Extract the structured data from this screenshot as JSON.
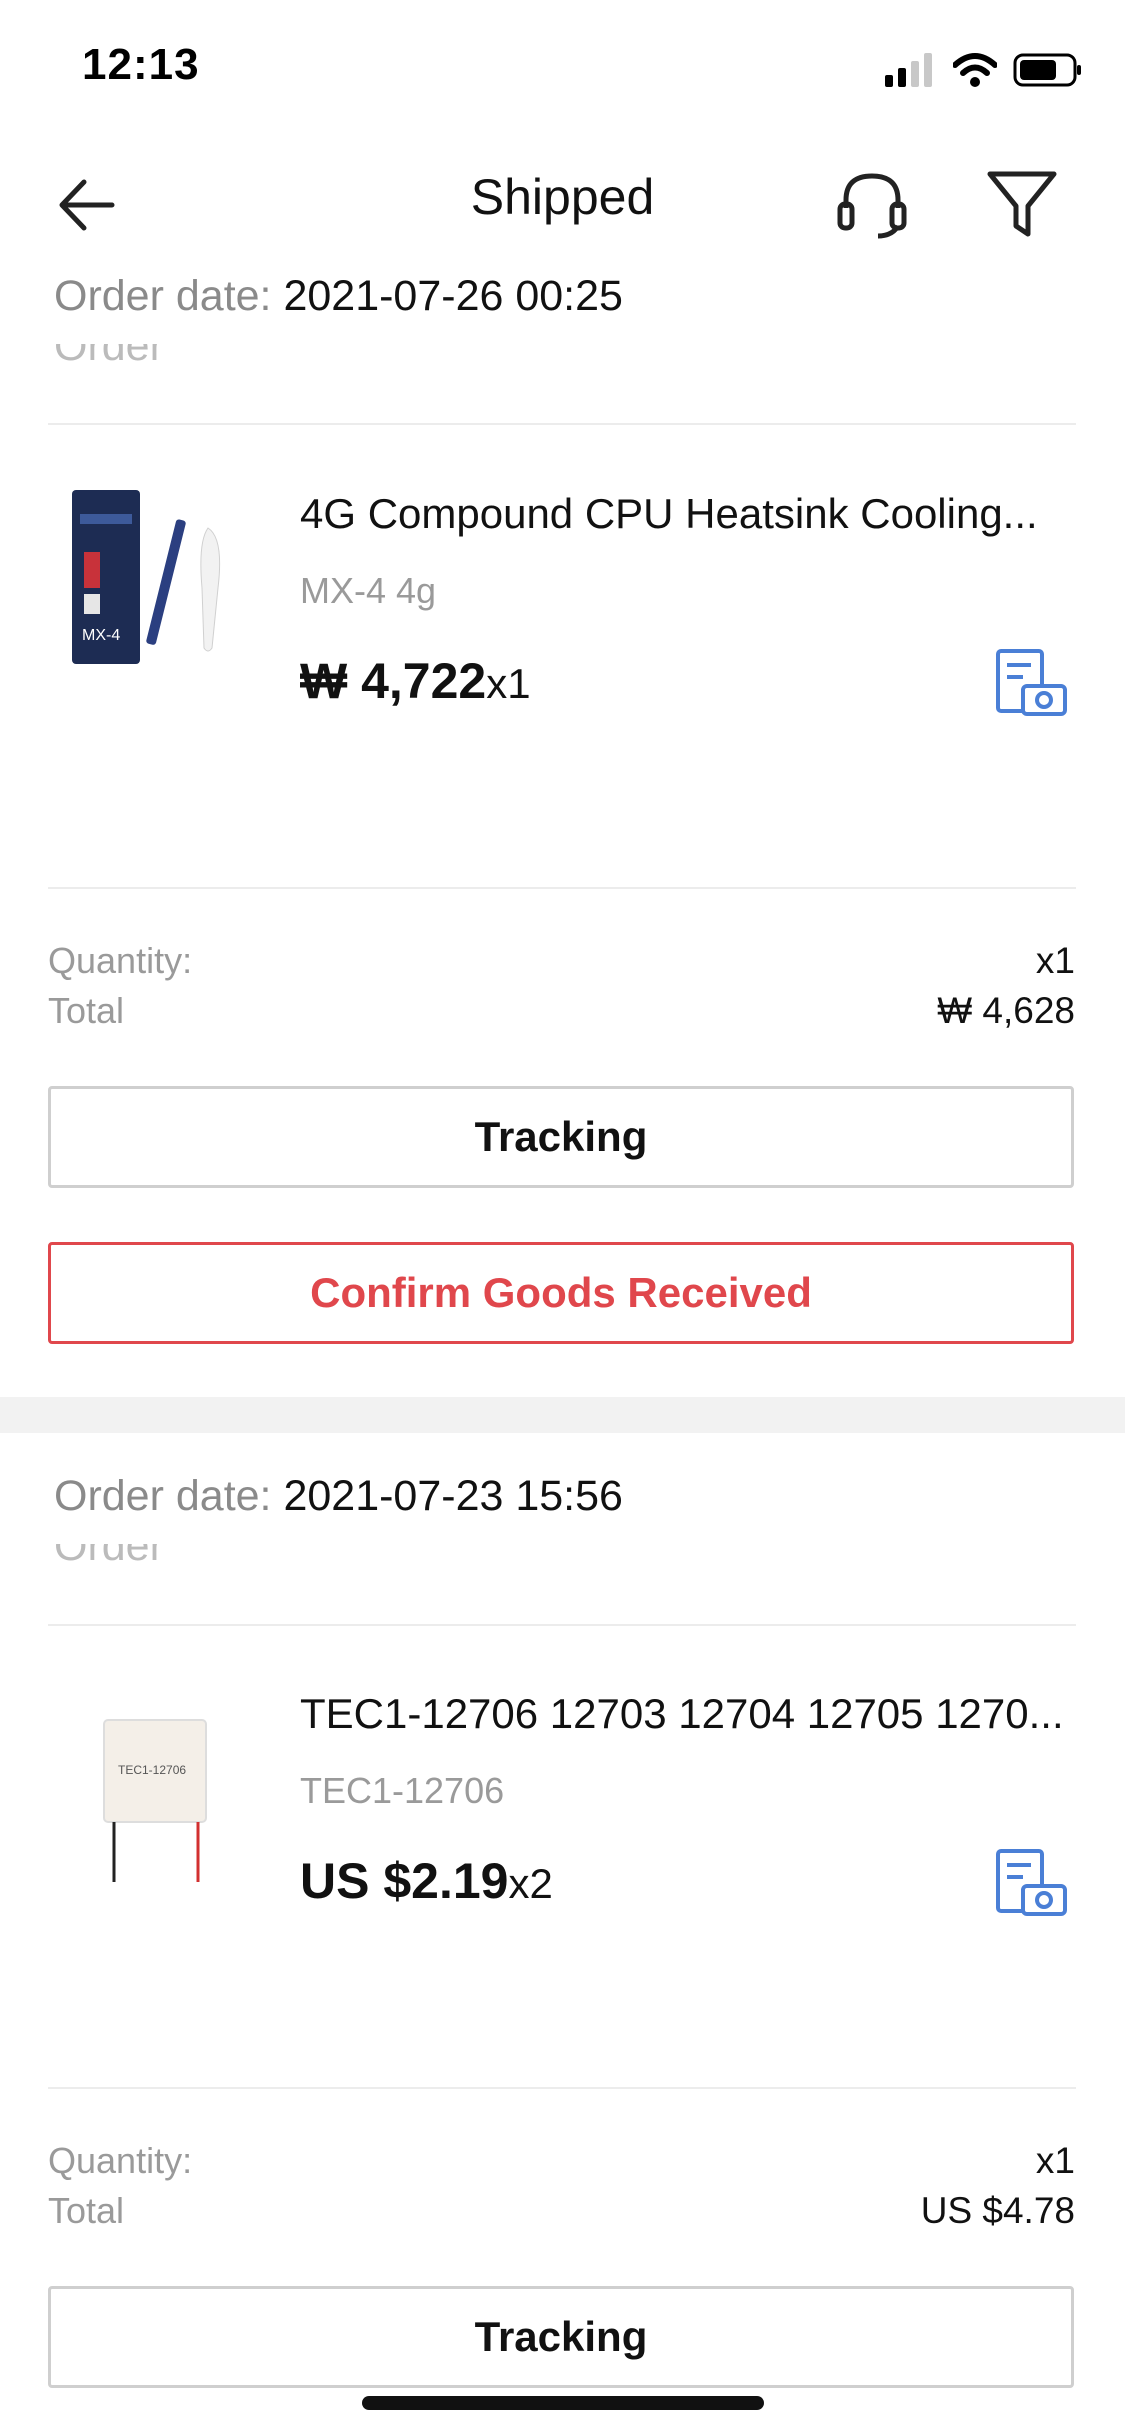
{
  "status_bar": {
    "time": "12:13"
  },
  "header": {
    "title": "Shipped"
  },
  "orders": [
    {
      "order_date_label": "Order date:",
      "order_date": "2021-07-26 00:25",
      "product": {
        "title": "4G Compound CPU Heatsink Cooling...",
        "variant": "MX-4 4g",
        "price": "₩ 4,722",
        "qty": "x1",
        "thumb_label": "MX-4"
      },
      "summary": {
        "quantity_label": "Quantity:",
        "quantity": "x1",
        "total_label": "Total",
        "total": "₩ 4,628"
      },
      "buttons": {
        "tracking": "Tracking",
        "confirm": "Confirm Goods Received"
      }
    },
    {
      "order_date_label": "Order date:",
      "order_date": "2021-07-23 15:56",
      "product": {
        "title": "TEC1-12706 12703 12704 12705 1270...",
        "variant": "TEC1-12706",
        "price": "US $2.19",
        "qty": "x2",
        "thumb_label": "TEC1-12706"
      },
      "summary": {
        "quantity_label": "Quantity:",
        "quantity": "x1",
        "total_label": "Total",
        "total": "US $4.78"
      },
      "buttons": {
        "tracking": "Tracking"
      }
    }
  ],
  "colors": {
    "accent": "#e0474c",
    "icon_blue": "#4a7fd6",
    "muted": "#9a9a9a"
  }
}
